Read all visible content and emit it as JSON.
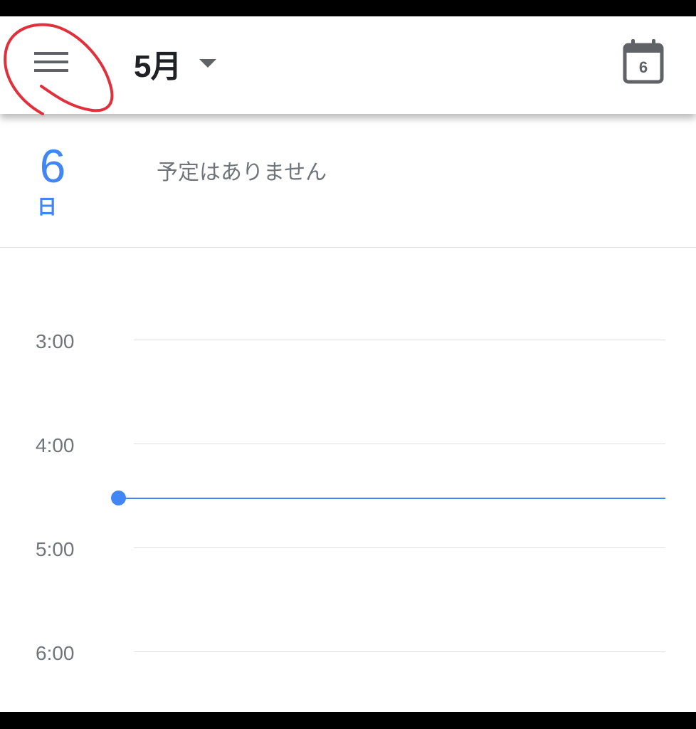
{
  "header": {
    "menu_icon": "hamburger-menu-icon",
    "month_title": "5月",
    "dropdown_icon": "dropdown-arrow-icon",
    "today_icon": "calendar-today-icon",
    "today_number": "6"
  },
  "day": {
    "number": "6",
    "weekday": "日",
    "no_events_text": "予定はありません"
  },
  "timeline": {
    "hours": [
      "3:00",
      "4:00",
      "5:00",
      "6:00"
    ]
  },
  "annotation": {
    "type": "red-circle",
    "color": "#e0303c",
    "target": "hamburger-menu-icon"
  },
  "colors": {
    "accent": "#4285f4",
    "text_primary": "#202124",
    "text_secondary": "#70757a"
  }
}
